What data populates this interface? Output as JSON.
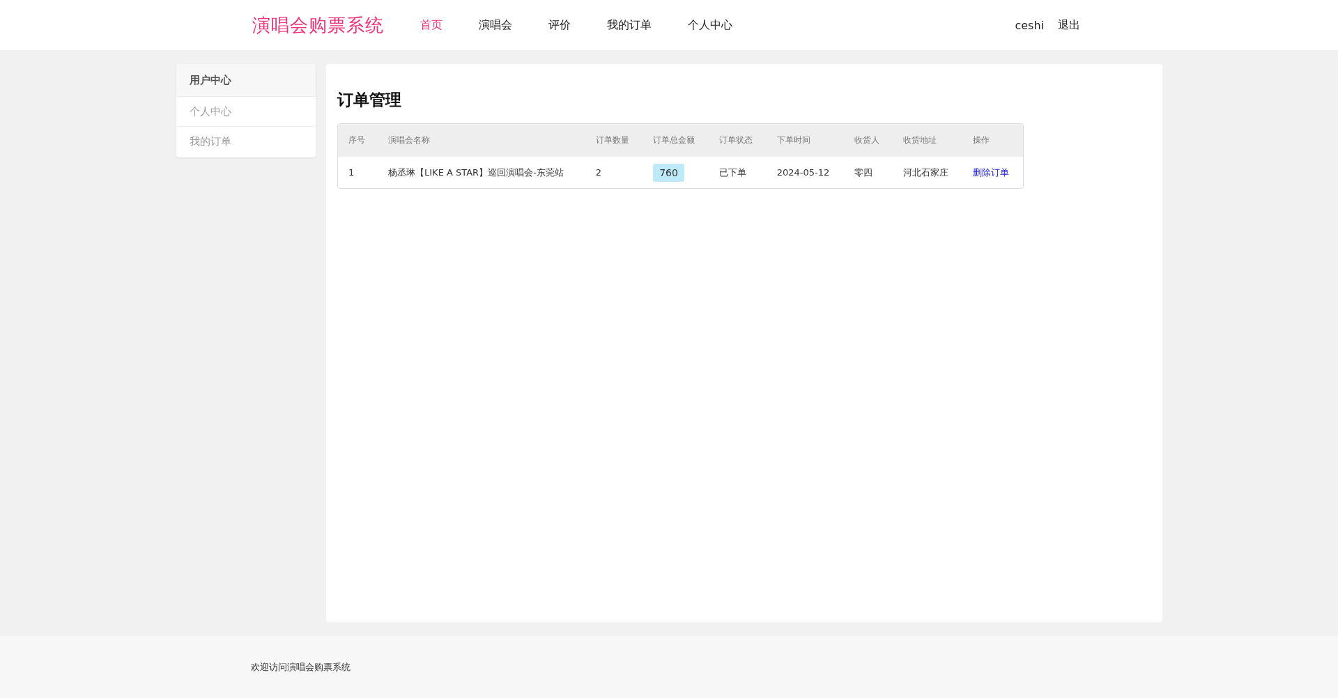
{
  "header": {
    "logo": "演唱会购票系统",
    "nav": [
      {
        "label": "首页",
        "selected": true
      },
      {
        "label": "演唱会",
        "selected": false
      },
      {
        "label": "评价",
        "selected": false
      },
      {
        "label": "我的订单",
        "selected": false
      },
      {
        "label": "个人中心",
        "selected": false
      }
    ],
    "user": "ceshi",
    "logout": "退出"
  },
  "sidebar": {
    "title": "用户中心",
    "items": [
      "个人中心",
      "我的订单"
    ]
  },
  "main": {
    "title": "订单管理",
    "table": {
      "columns": [
        "序号",
        "演唱会名称",
        "订单数量",
        "订单总金额",
        "订单状态",
        "下单时间",
        "收货人",
        "收货地址",
        "操作"
      ],
      "rows": [
        {
          "index": "1",
          "name": "杨丞琳【LIKE A STAR】巡回演唱会-东莞站",
          "quantity": "2",
          "amount": "760",
          "status": "已下单",
          "time": "2024-05-12",
          "receiver": "零四",
          "address": "河北石家庄",
          "action": "删除订单"
        }
      ]
    }
  },
  "footer": "欢迎访问演唱会购票系统"
}
